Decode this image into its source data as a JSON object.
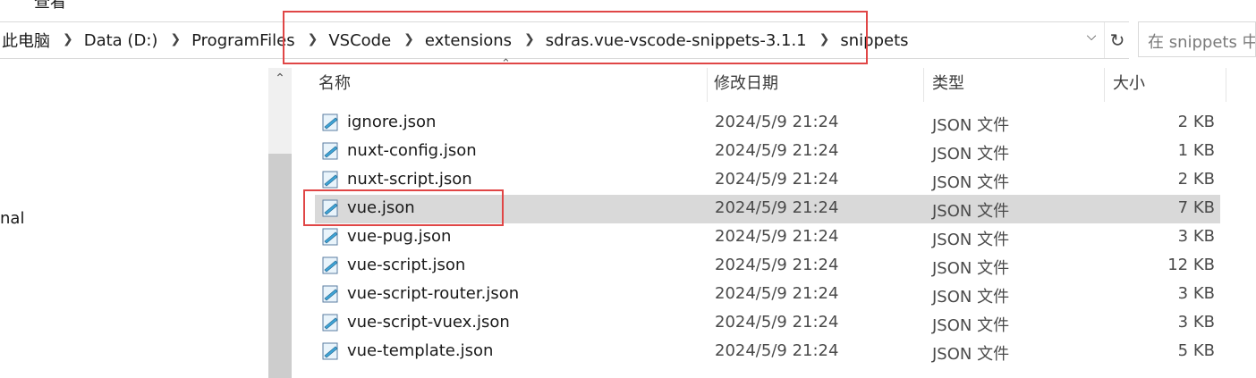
{
  "ribbon": {
    "view_label": "查看"
  },
  "address": {
    "crumbs": [
      "此电脑",
      "Data (D:)",
      "ProgramFiles",
      "VSCode",
      "extensions",
      "sdras.vue-vscode-snippets-3.1.1",
      "snippets"
    ],
    "separator_icon": "chevron-right-icon",
    "dropdown_icon": "chevron-down-icon",
    "refresh_icon": "refresh-icon"
  },
  "search": {
    "placeholder": "在 snippets 中搜索"
  },
  "nav": {
    "partial_item": "nal"
  },
  "columns": {
    "name": "名称",
    "date": "修改日期",
    "type": "类型",
    "size": "大小"
  },
  "files": [
    {
      "name": "ignore.json",
      "date": "2024/5/9 21:24",
      "type": "JSON 文件",
      "size": "2 KB",
      "selected": false
    },
    {
      "name": "nuxt-config.json",
      "date": "2024/5/9 21:24",
      "type": "JSON 文件",
      "size": "1 KB",
      "selected": false
    },
    {
      "name": "nuxt-script.json",
      "date": "2024/5/9 21:24",
      "type": "JSON 文件",
      "size": "2 KB",
      "selected": false
    },
    {
      "name": "vue.json",
      "date": "2024/5/9 21:24",
      "type": "JSON 文件",
      "size": "7 KB",
      "selected": true
    },
    {
      "name": "vue-pug.json",
      "date": "2024/5/9 21:24",
      "type": "JSON 文件",
      "size": "3 KB",
      "selected": false
    },
    {
      "name": "vue-script.json",
      "date": "2024/5/9 21:24",
      "type": "JSON 文件",
      "size": "12 KB",
      "selected": false
    },
    {
      "name": "vue-script-router.json",
      "date": "2024/5/9 21:24",
      "type": "JSON 文件",
      "size": "3 KB",
      "selected": false
    },
    {
      "name": "vue-script-vuex.json",
      "date": "2024/5/9 21:24",
      "type": "JSON 文件",
      "size": "3 KB",
      "selected": false
    },
    {
      "name": "vue-template.json",
      "date": "2024/5/9 21:24",
      "type": "JSON 文件",
      "size": "5 KB",
      "selected": false
    }
  ],
  "colors": {
    "highlight_border": "#e04646",
    "selected_row": "#d9d9d9"
  }
}
